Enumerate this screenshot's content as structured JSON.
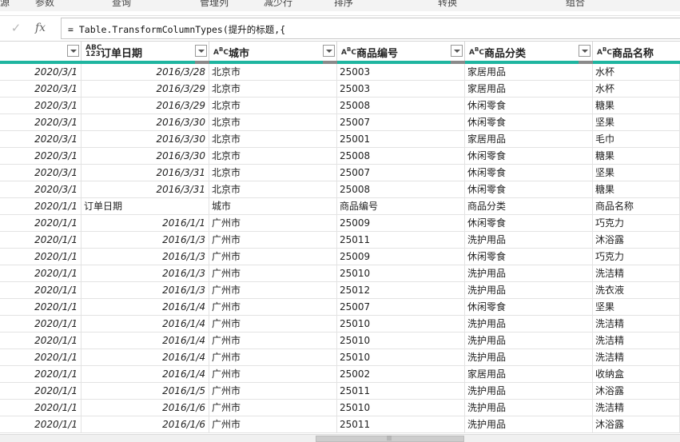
{
  "ribbon": {
    "items": [
      "源",
      "参数",
      "查询",
      "管理列",
      "减少行",
      "排序",
      "转换",
      "组合"
    ]
  },
  "formula_bar": {
    "check_icon": "check-icon",
    "fx_label": "fx",
    "formula": "= Table.TransformColumnTypes(提升的标题,{"
  },
  "columns": [
    {
      "title": "",
      "type": "date"
    },
    {
      "title": "订单日期",
      "type": "ABC\n123"
    },
    {
      "title": "城市",
      "type": "ABC"
    },
    {
      "title": "商品编号",
      "type": "ABC"
    },
    {
      "title": "商品分类",
      "type": "ABC"
    },
    {
      "title": "商品名称",
      "type": "ABC"
    }
  ],
  "rows": [
    [
      "2020/3/1",
      "2016/3/28",
      "北京市",
      "25003",
      "家居用品",
      "水杯"
    ],
    [
      "2020/3/1",
      "2016/3/29",
      "北京市",
      "25003",
      "家居用品",
      "水杯"
    ],
    [
      "2020/3/1",
      "2016/3/29",
      "北京市",
      "25008",
      "休闲零食",
      "糖果"
    ],
    [
      "2020/3/1",
      "2016/3/30",
      "北京市",
      "25007",
      "休闲零食",
      "坚果"
    ],
    [
      "2020/3/1",
      "2016/3/30",
      "北京市",
      "25001",
      "家居用品",
      "毛巾"
    ],
    [
      "2020/3/1",
      "2016/3/30",
      "北京市",
      "25008",
      "休闲零食",
      "糖果"
    ],
    [
      "2020/3/1",
      "2016/3/31",
      "北京市",
      "25007",
      "休闲零食",
      "坚果"
    ],
    [
      "2020/3/1",
      "2016/3/31",
      "北京市",
      "25008",
      "休闲零食",
      "糖果"
    ],
    [
      "2020/1/1",
      "订单日期",
      "城市",
      "商品编号",
      "商品分类",
      "商品名称"
    ],
    [
      "2020/1/1",
      "2016/1/1",
      "广州市",
      "25009",
      "休闲零食",
      "巧克力"
    ],
    [
      "2020/1/1",
      "2016/1/3",
      "广州市",
      "25011",
      "洗护用品",
      "沐浴露"
    ],
    [
      "2020/1/1",
      "2016/1/3",
      "广州市",
      "25009",
      "休闲零食",
      "巧克力"
    ],
    [
      "2020/1/1",
      "2016/1/3",
      "广州市",
      "25010",
      "洗护用品",
      "洗洁精"
    ],
    [
      "2020/1/1",
      "2016/1/3",
      "广州市",
      "25012",
      "洗护用品",
      "洗衣液"
    ],
    [
      "2020/1/1",
      "2016/1/4",
      "广州市",
      "25007",
      "休闲零食",
      "坚果"
    ],
    [
      "2020/1/1",
      "2016/1/4",
      "广州市",
      "25010",
      "洗护用品",
      "洗洁精"
    ],
    [
      "2020/1/1",
      "2016/1/4",
      "广州市",
      "25010",
      "洗护用品",
      "洗洁精"
    ],
    [
      "2020/1/1",
      "2016/1/4",
      "广州市",
      "25010",
      "洗护用品",
      "洗洁精"
    ],
    [
      "2020/1/1",
      "2016/1/4",
      "广州市",
      "25002",
      "家居用品",
      "收纳盒"
    ],
    [
      "2020/1/1",
      "2016/1/5",
      "广州市",
      "25011",
      "洗护用品",
      "沐浴露"
    ],
    [
      "2020/1/1",
      "2016/1/6",
      "广州市",
      "25010",
      "洗护用品",
      "洗洁精"
    ],
    [
      "2020/1/1",
      "2016/1/6",
      "广州市",
      "25011",
      "洗护用品",
      "沐浴露"
    ]
  ],
  "colors": {
    "column_quality_bar": "#1fb5a0",
    "grid_line": "#e3e3e3"
  }
}
